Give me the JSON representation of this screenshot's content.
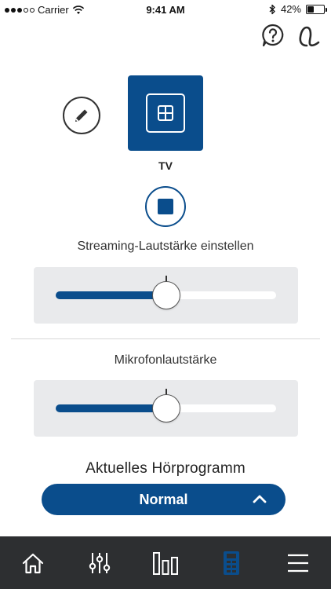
{
  "status_bar": {
    "carrier": "Carrier",
    "time": "9:41 AM",
    "battery": "42%",
    "battery_level": 0.42
  },
  "header": {
    "help_icon": "question-bubble-icon",
    "device_icon": "hearing-aid-icon"
  },
  "source": {
    "label": "TV",
    "icon": "tv-streamer-icon",
    "edit_icon": "pencil-icon",
    "stop_icon": "stop-icon"
  },
  "streaming_volume": {
    "label": "Streaming-Lautstärke einstellen",
    "level": 0.5
  },
  "microphone_volume": {
    "label": "Mikrofonlautstärke",
    "level": 0.5
  },
  "program": {
    "heading": "Aktuelles Hörprogramm",
    "current": "Normal",
    "chevron": "chevron-up-icon"
  },
  "bottom_nav": {
    "items": [
      {
        "icon": "home-icon",
        "active": false
      },
      {
        "icon": "equalizer-icon",
        "active": false
      },
      {
        "icon": "bar-chart-icon",
        "active": false
      },
      {
        "icon": "remote-control-icon",
        "active": true
      },
      {
        "icon": "menu-icon",
        "active": false
      }
    ]
  },
  "colors": {
    "accent": "#0a4d8c",
    "nav_background": "#2d2f31",
    "panel_background": "#e9eaec"
  }
}
